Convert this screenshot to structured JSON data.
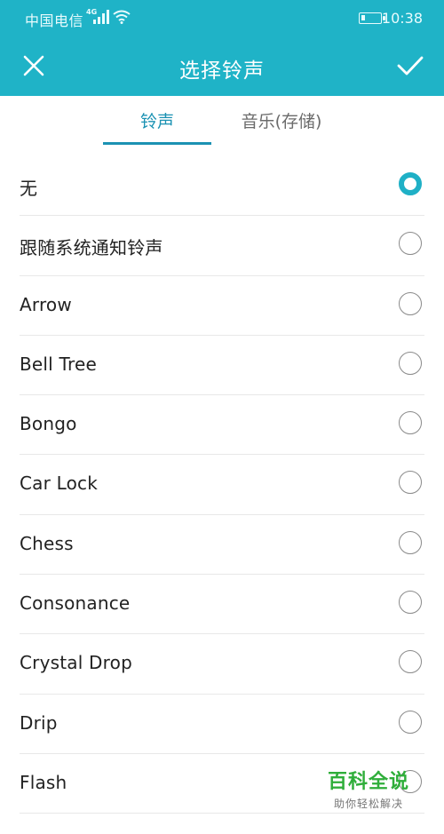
{
  "status_bar": {
    "carrier": "中国电信",
    "network_type": "4G",
    "time": "10:38",
    "battery_level": 0.2
  },
  "app_bar": {
    "title": "选择铃声",
    "close_icon": "close-icon",
    "confirm_icon": "check-icon"
  },
  "tabs": [
    {
      "label": "铃声",
      "selected": true
    },
    {
      "label": "音乐(存储)",
      "selected": false
    }
  ],
  "ringtones": [
    {
      "label": "无",
      "selected": true
    },
    {
      "label": "跟随系统通知铃声",
      "selected": false
    },
    {
      "label": "Arrow",
      "selected": false
    },
    {
      "label": "Bell Tree",
      "selected": false
    },
    {
      "label": "Bongo",
      "selected": false
    },
    {
      "label": "Car Lock",
      "selected": false
    },
    {
      "label": "Chess",
      "selected": false
    },
    {
      "label": "Consonance",
      "selected": false
    },
    {
      "label": "Crystal Drop",
      "selected": false
    },
    {
      "label": "Drip",
      "selected": false
    },
    {
      "label": "Flash",
      "selected": false
    }
  ],
  "watermark": {
    "title": "百科全说",
    "subtitle": "助你轻松解决"
  },
  "colors": {
    "accent": "#1fb3c7",
    "tab_active": "#1b92b3",
    "watermark_green": "#2fae3a"
  }
}
